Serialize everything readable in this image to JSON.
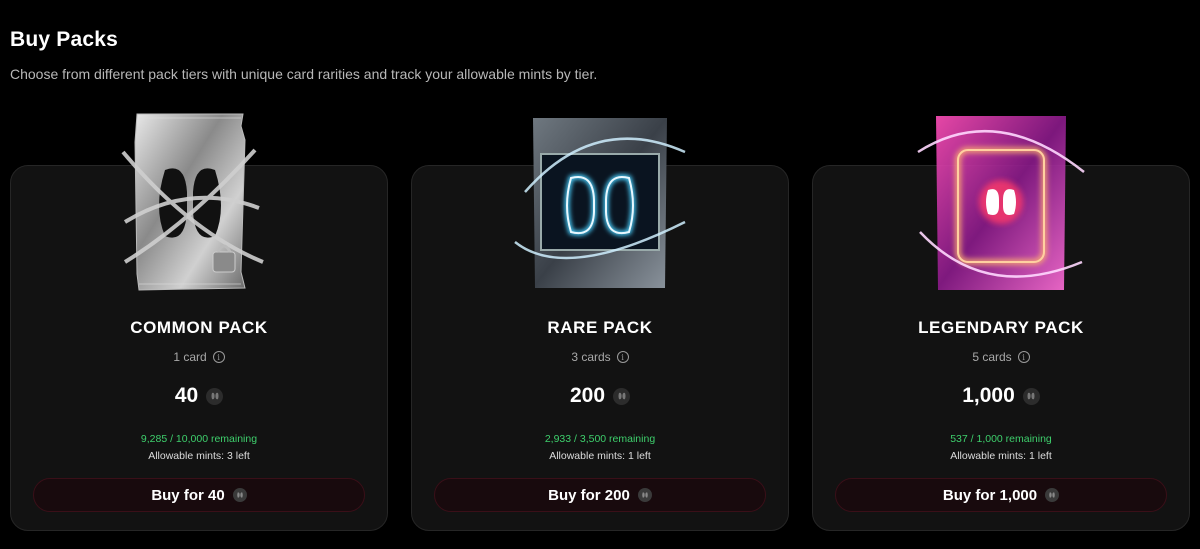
{
  "page": {
    "title": "Buy Packs",
    "subtitle": "Choose from different pack tiers with unique card rarities and track your allowable mints by tier."
  },
  "packs": [
    {
      "name": "COMMON PACK",
      "cards": "1 card",
      "price": "40",
      "remaining": "9,285 / 10,000 remaining",
      "mints": "Allowable mints: 3 left",
      "buy_label": "Buy for 40",
      "art": "chained-silver-pack-image",
      "accent": "#c8c8c8"
    },
    {
      "name": "RARE PACK",
      "cards": "3 cards",
      "price": "200",
      "remaining": "2,933 / 3,500 remaining",
      "mints": "Allowable mints: 1 left",
      "buy_label": "Buy for 200",
      "art": "neon-blue-pack-image",
      "accent": "#6fb8ff"
    },
    {
      "name": "LEGENDARY PACK",
      "cards": "5 cards",
      "price": "1,000",
      "remaining": "537 / 1,000 remaining",
      "mints": "Allowable mints: 1 left",
      "buy_label": "Buy for 1,000",
      "art": "neon-pink-pack-image",
      "accent": "#ff4fd2"
    }
  ],
  "colors": {
    "background": "#000000",
    "card": "#121212",
    "remaining_text": "#3ecf6c",
    "button_bg": "#180a0d"
  },
  "icons": {
    "info": "info-circle-icon",
    "token": "token-coin-icon"
  }
}
